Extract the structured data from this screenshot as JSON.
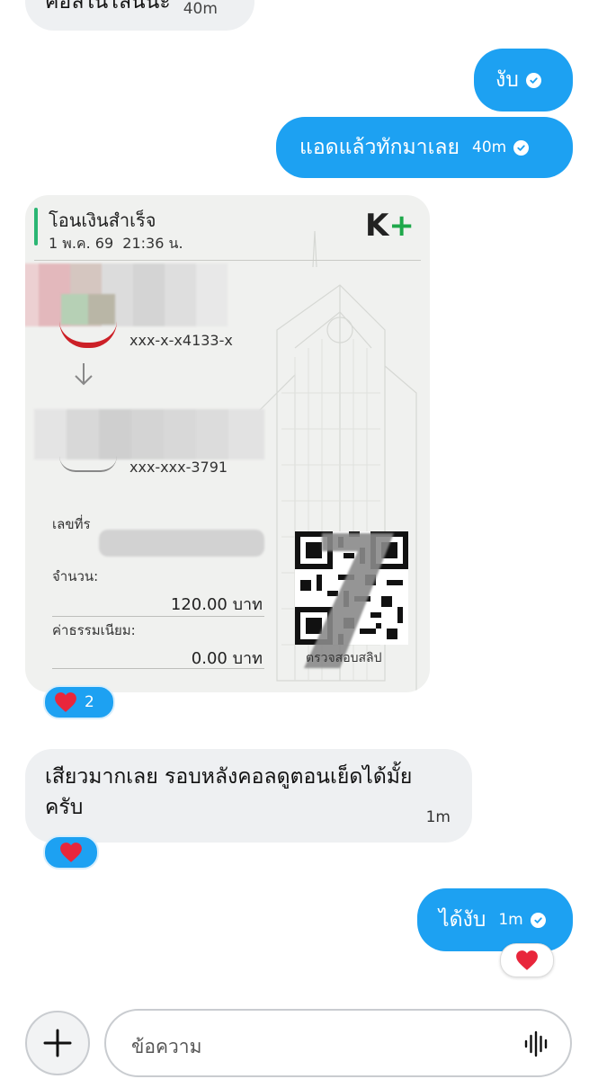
{
  "messages": {
    "top_partial": {
      "text": "คอลในไลน์นะ",
      "time": "40m"
    },
    "out1": {
      "text": "งับ"
    },
    "out2": {
      "text": "แอดแล้วทักมาเลย",
      "time": "40m"
    },
    "slip": {
      "title": "โอนเงินสำเร็จ",
      "datetime": "1 พ.ค. 69  21:36 น.",
      "bank_logo": "K+",
      "from_account": "xxx-x-x4133-x",
      "to_account": "xxx-xxx-3791",
      "ref_label": "เลขที่ร",
      "amount_label": "จำนวน:",
      "amount_value": "120.00 บาท",
      "fee_label": "ค่าธรรมเนียม:",
      "fee_value": "0.00 บาท",
      "qr_caption": "ตรวจสอบสลิป",
      "reaction_count": "2"
    },
    "in2": {
      "text": "เสียวมากเลย รอบหลังคอลดูตอนเย็ดได้มั้ยครับ",
      "time": "1m"
    },
    "out3": {
      "text": "ได้งับ",
      "time": "1m"
    }
  },
  "composer": {
    "placeholder": "ข้อความ"
  },
  "icons": [
    "check-icon",
    "heart-icon",
    "arrow-down-icon",
    "plus-icon",
    "voice-icon"
  ],
  "colors": {
    "outgoing": "#1da1f2",
    "incoming": "#eef0f2",
    "heart": "#e8263b"
  }
}
